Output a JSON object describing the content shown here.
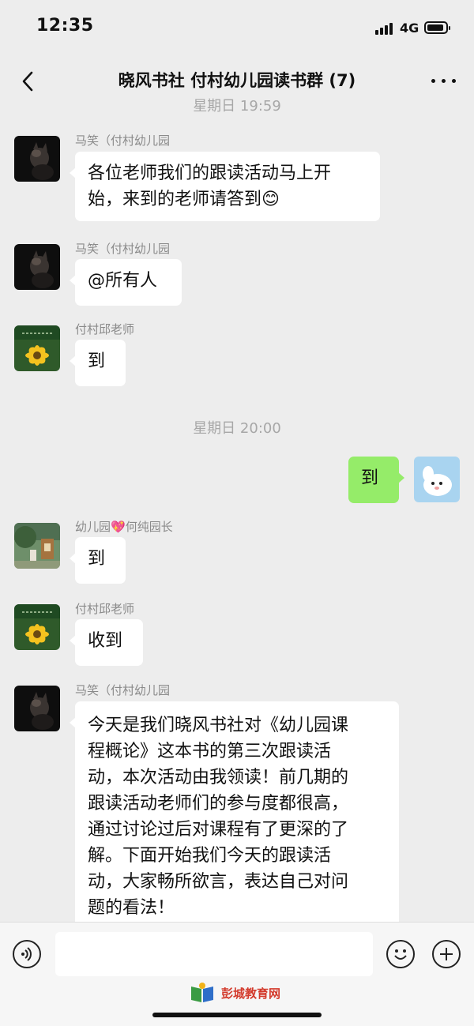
{
  "status": {
    "time": "12:35",
    "network": "4G"
  },
  "nav": {
    "title": "晓风书社 付村幼儿园读书群 (7)"
  },
  "timestamps": [
    "星期日 19:59",
    "星期日 20:00"
  ],
  "messages": [
    {
      "sender": "马笑（付村幼儿园",
      "avatar": "cat-avatar",
      "text": "各位老师我们的跟读活动马上开\n始，来到的老师请答到",
      "emoji": "😊"
    },
    {
      "sender": "马笑（付村幼儿园",
      "avatar": "cat-avatar",
      "text": "@所有人"
    },
    {
      "sender": "付村邱老师",
      "avatar": "sunflower-avatar",
      "text": "到"
    },
    {
      "sender": "me",
      "avatar": "cartoon-avatar",
      "text": "到"
    },
    {
      "sender_prefix": "幼儿园",
      "sender_heart": "💖",
      "sender_suffix": "何纯园长",
      "avatar": "garden-avatar",
      "text": "到"
    },
    {
      "sender": "付村邱老师",
      "avatar": "sunflower-avatar",
      "text": "收到"
    },
    {
      "sender": "马笑（付村幼儿园",
      "avatar": "cat-avatar",
      "text": "今天是我们晓风书社对《幼儿园课\n程概论》这本书的第三次跟读活\n动，本次活动由我领读！前几期的\n跟读活动老师们的参与度都很高，\n通过讨论过后对课程有了更深的了\n解。下面开始我们今天的跟读活\n动，大家畅所欲言，表达自己对问\n题的看法！"
    }
  ],
  "input": {
    "voice_icon": "voice-icon",
    "emoji_icon": "smiley-icon",
    "plus_icon": "plus-icon"
  },
  "watermark": {
    "text": "彭城教育网"
  },
  "colors": {
    "background": "#ededed",
    "my_bubble": "#95ec69",
    "other_bubble": "#ffffff"
  }
}
